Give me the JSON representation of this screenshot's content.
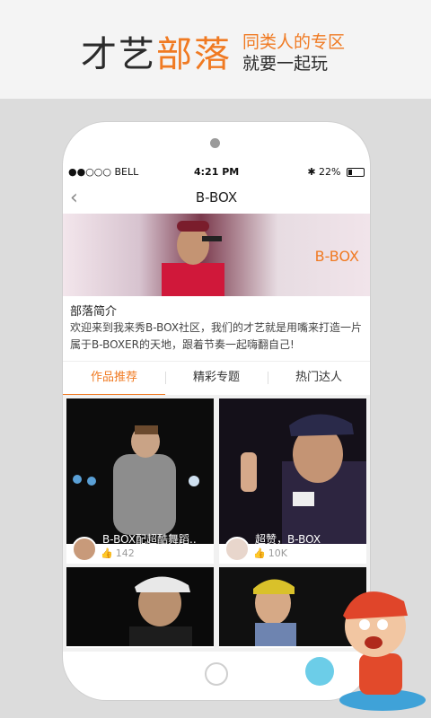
{
  "promo": {
    "main_part1": "才艺",
    "main_part2": "部落",
    "sub1": "同类人的专区",
    "sub2": "就要一起玩"
  },
  "statusbar": {
    "carrier": "●●○○○ BELL",
    "time": "4:21 PM",
    "battery_text": "22%",
    "battery_level": 0.22
  },
  "nav": {
    "back_icon": "chevron-left-icon",
    "title": "B-BOX"
  },
  "banner": {
    "label": "B-BOX"
  },
  "intro": {
    "title": "部落简介",
    "description": "欢迎来到我来秀B-BOX社区，我们的才艺就是用嘴来打造一片属于B-BOXER的天地，跟着节奏一起嗨翻自己!"
  },
  "tabs": [
    {
      "label": "作品推荐",
      "active": true
    },
    {
      "label": "精彩专题",
      "active": false
    },
    {
      "label": "热门达人",
      "active": false
    }
  ],
  "cards": [
    {
      "caption": "B-BOX配超酷舞蹈..",
      "likes": "142"
    },
    {
      "caption": "超赞，B-BOX",
      "likes": "10K"
    },
    {
      "caption": "",
      "likes": ""
    },
    {
      "caption": "",
      "likes": ""
    }
  ],
  "colors": {
    "accent": "#f07a22"
  }
}
